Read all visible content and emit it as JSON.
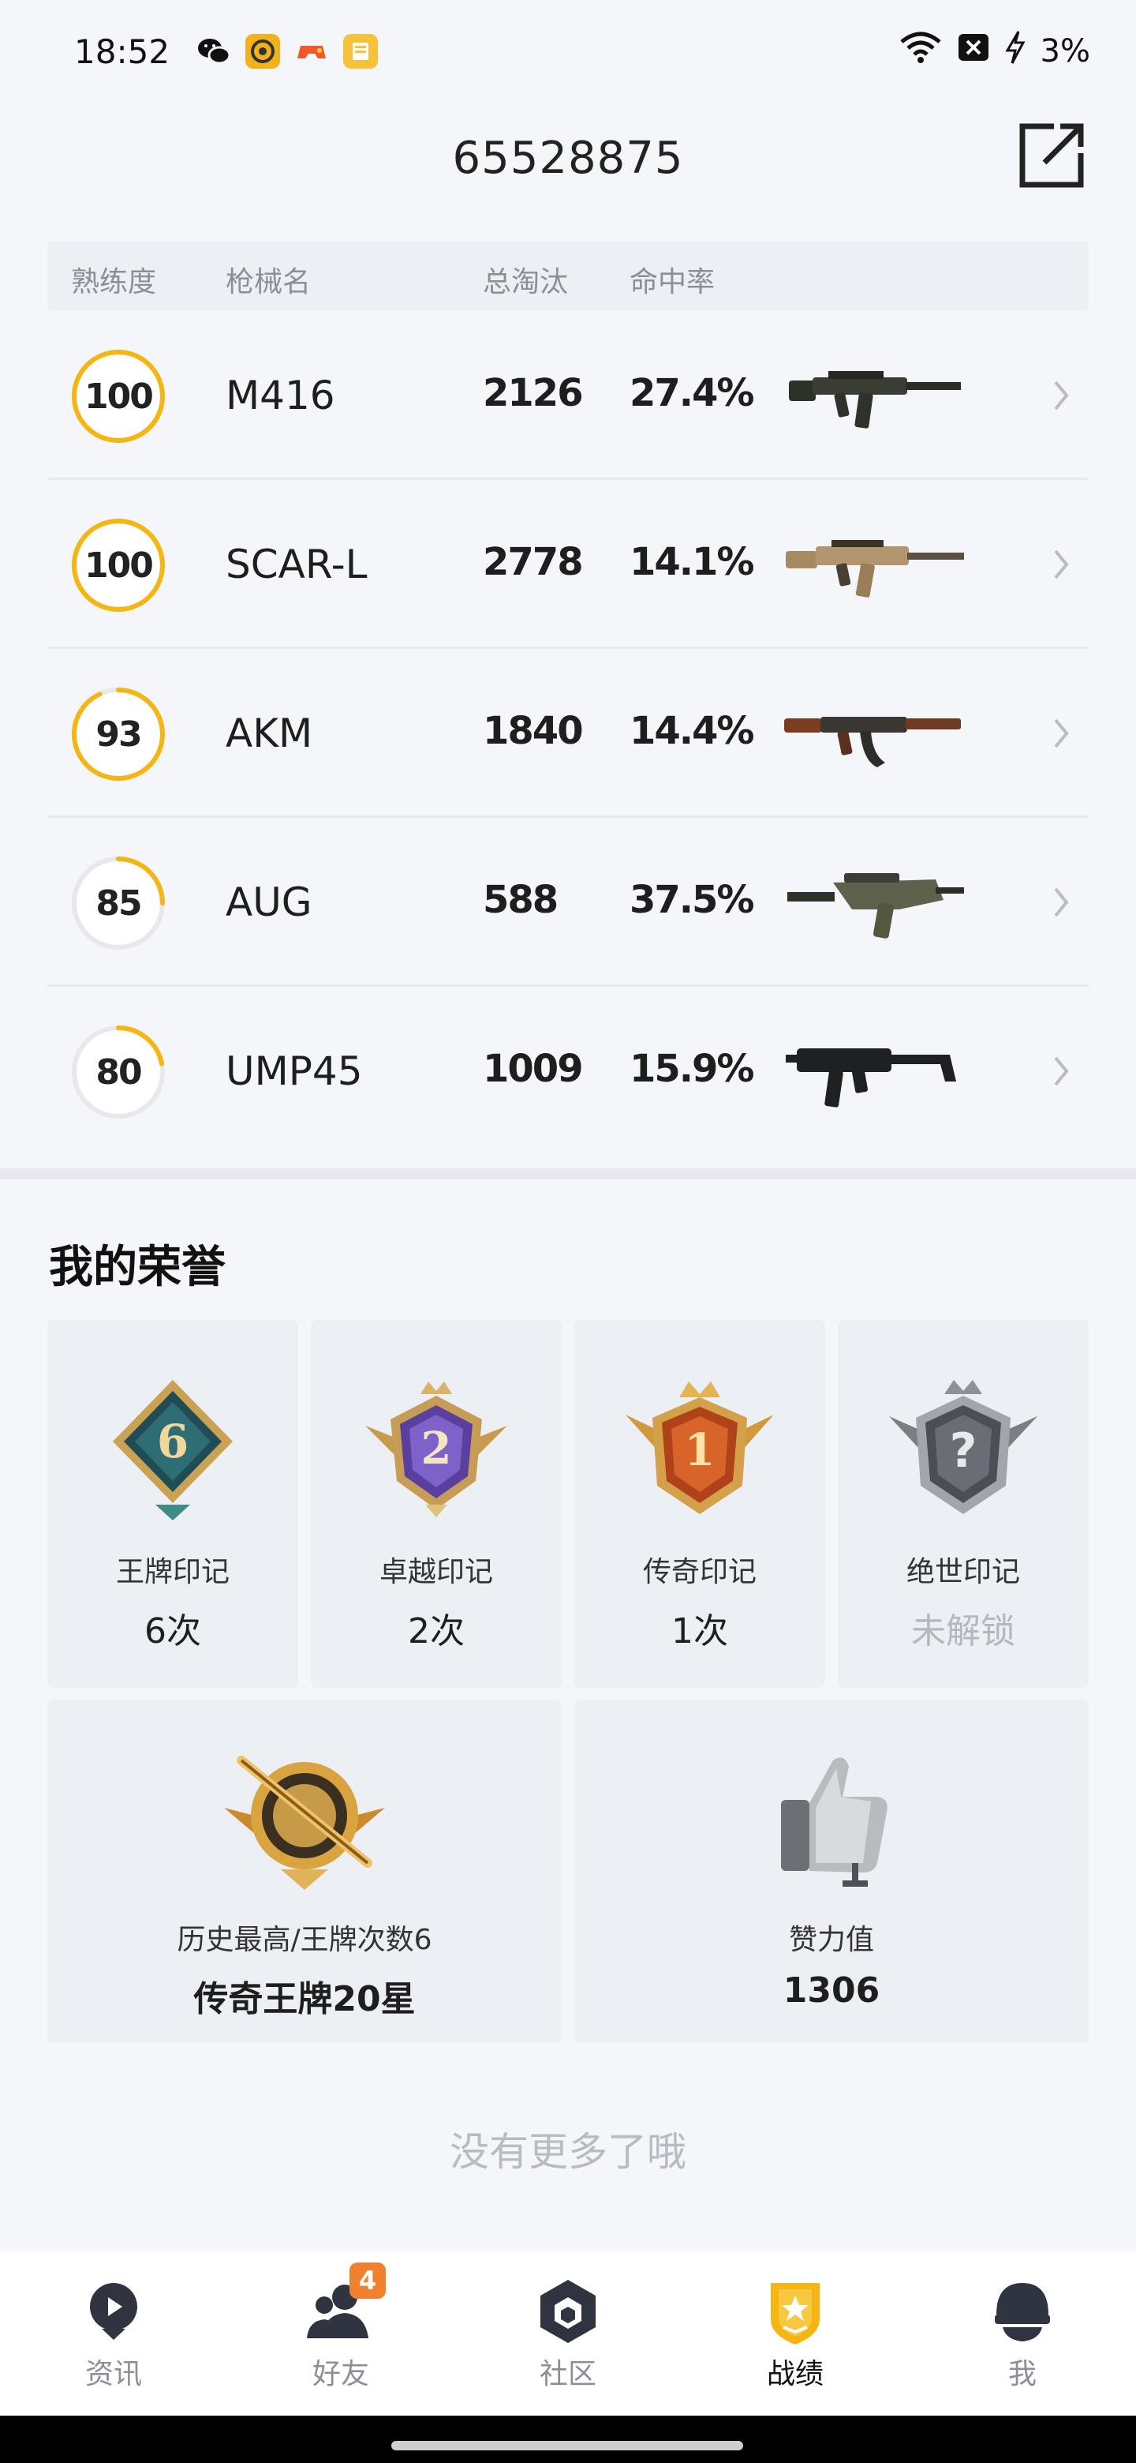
{
  "status_bar": {
    "time": "18:52",
    "battery": "3%",
    "icons": [
      "wechat-icon",
      "music-app-icon",
      "game-app-icon",
      "reader-app-icon",
      "wifi-icon",
      "no-sim-icon",
      "charging-icon"
    ]
  },
  "header": {
    "title": "65528875",
    "share_icon": "external-link-icon"
  },
  "weapon_table": {
    "headers": {
      "proficiency": "熟练度",
      "weapon_name": "枪械名",
      "eliminations": "总淘汰",
      "hit_rate": "命中率"
    },
    "rows": [
      {
        "proficiency": "100",
        "proficiency_level": 1.0,
        "name": "M416",
        "eliminations": "2126",
        "hit_rate": "27.4%",
        "gun": "m416"
      },
      {
        "proficiency": "100",
        "proficiency_level": 1.0,
        "name": "SCAR-L",
        "eliminations": "2778",
        "hit_rate": "14.1%",
        "gun": "scar"
      },
      {
        "proficiency": "93",
        "proficiency_level": 0.93,
        "name": "AKM",
        "eliminations": "1840",
        "hit_rate": "14.4%",
        "gun": "akm"
      },
      {
        "proficiency": "85",
        "proficiency_level": 0.25,
        "name": "AUG",
        "eliminations": "588",
        "hit_rate": "37.5%",
        "gun": "aug"
      },
      {
        "proficiency": "80",
        "proficiency_level": 0.22,
        "name": "UMP45",
        "eliminations": "1009",
        "hit_rate": "15.9%",
        "gun": "ump"
      }
    ]
  },
  "honors": {
    "title": "我的荣誉",
    "cards": [
      {
        "label": "王牌印记",
        "value": "6次",
        "badge": "ace-mark-badge",
        "number": "6"
      },
      {
        "label": "卓越印记",
        "value": "2次",
        "badge": "excellence-mark-badge",
        "number": "2"
      },
      {
        "label": "传奇印记",
        "value": "1次",
        "badge": "legend-mark-badge",
        "number": "1"
      },
      {
        "label": "绝世印记",
        "value": "未解锁",
        "badge": "locked-mark-badge",
        "number": "?"
      }
    ],
    "wide_cards": [
      {
        "label": "历史最高/王牌次数6",
        "value": "传奇王牌20星",
        "badge": "rank-badge"
      },
      {
        "label": "赞力值",
        "value": "1306",
        "badge": "thumbs-up-icon"
      }
    ]
  },
  "footer_text": "没有更多了哦",
  "bottom_nav": {
    "items": [
      {
        "label": "资讯",
        "icon": "news-icon"
      },
      {
        "label": "好友",
        "icon": "friends-icon",
        "badge": "4"
      },
      {
        "label": "社区",
        "icon": "community-icon"
      },
      {
        "label": "战绩",
        "icon": "record-icon",
        "active": true
      },
      {
        "label": "我",
        "icon": "profile-icon"
      }
    ]
  },
  "colors": {
    "accent": "#f5b512",
    "ring_track": "#e6e8ec",
    "badge_orange": "#f0822f"
  }
}
